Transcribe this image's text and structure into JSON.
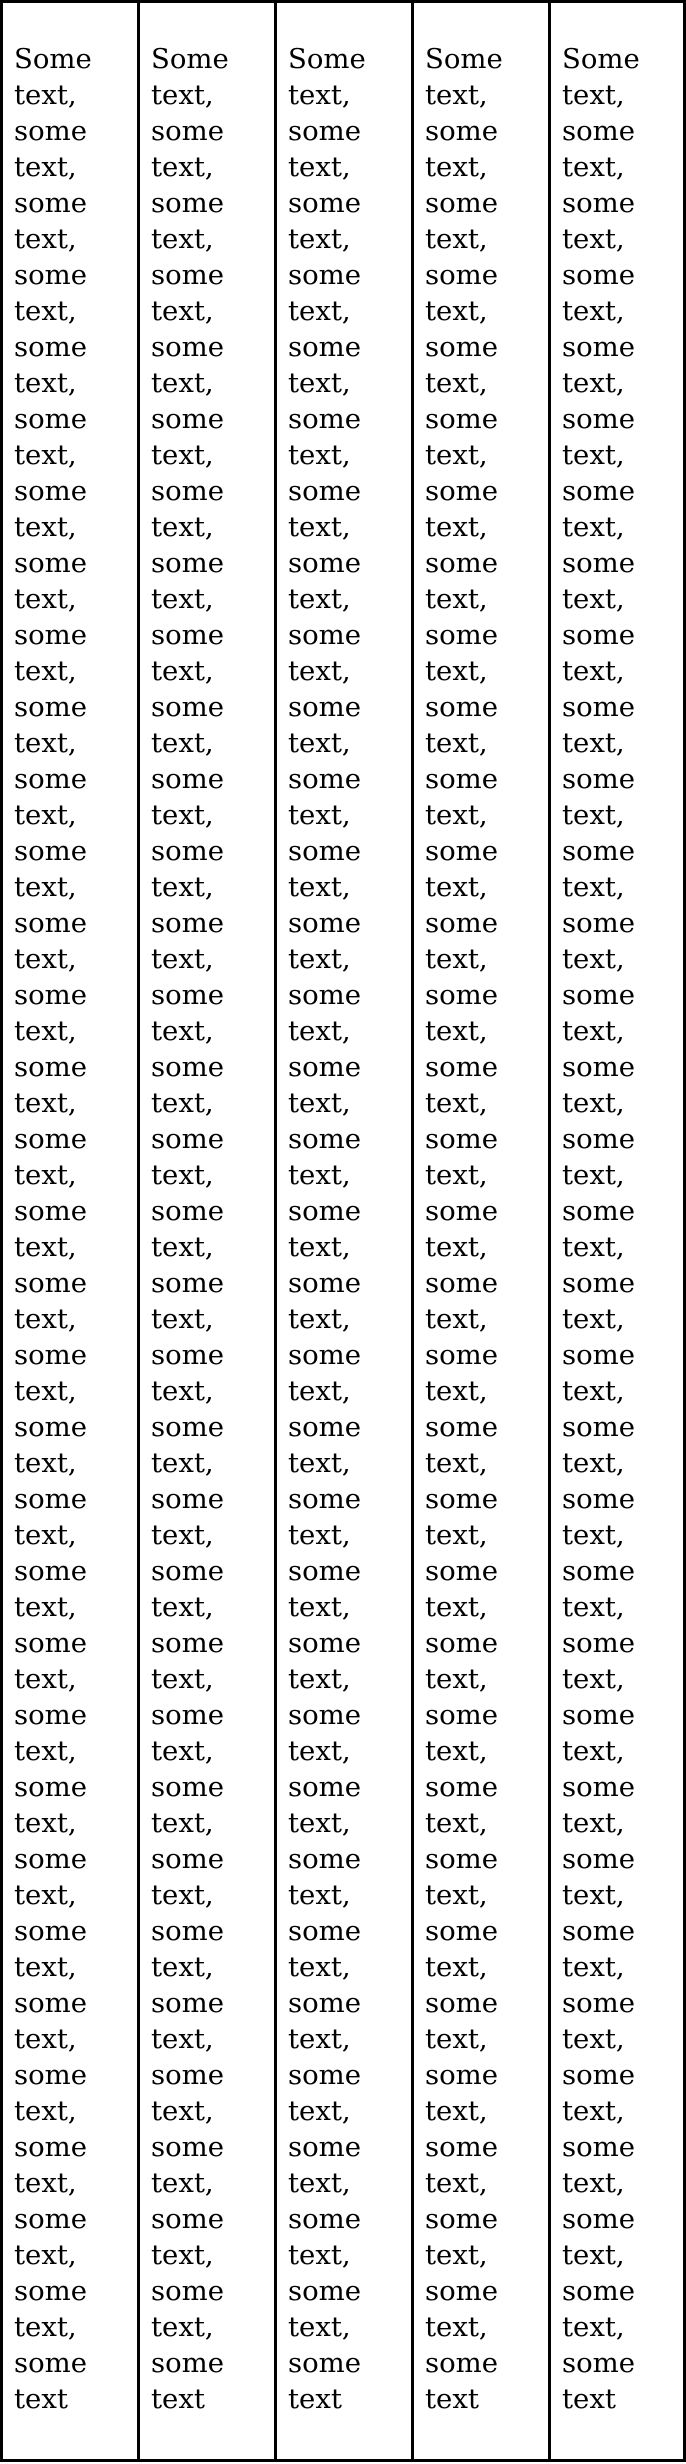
{
  "columns": [
    {
      "text": "Some text, some text, some text, some text, some text, some text, some text, some text, some text, some text, some text, some text, some text, some text, some text, some text, some text, some text, some text, some text, some text, some text, some text, some text, some text, some text, some text, some text, some text, some text, some text, some text, some text"
    },
    {
      "text": "Some text, some text, some text, some text, some text, some text, some text, some text, some text, some text, some text, some text, some text, some text, some text, some text, some text, some text, some text, some text, some text, some text, some text, some text, some text, some text, some text, some text, some text, some text, some text, some text, some text"
    },
    {
      "text": "Some text, some text, some text, some text, some text, some text, some text, some text, some text, some text, some text, some text, some text, some text, some text, some text, some text, some text, some text, some text, some text, some text, some text, some text, some text, some text, some text, some text, some text, some text, some text, some text, some text"
    },
    {
      "text": "Some text, some text, some text, some text, some text, some text, some text, some text, some text, some text, some text, some text, some text, some text, some text, some text, some text, some text, some text, some text, some text, some text, some text, some text, some text, some text, some text, some text, some text, some text, some text, some text, some text"
    },
    {
      "text": "Some text, some text, some text, some text, some text, some text, some text, some text, some text, some text, some text, some text, some text, some text, some text, some text, some text, some text, some text, some text, some text, some text, some text, some text, some text, some text, some text, some text, some text, some text, some text, some text, some text"
    }
  ]
}
